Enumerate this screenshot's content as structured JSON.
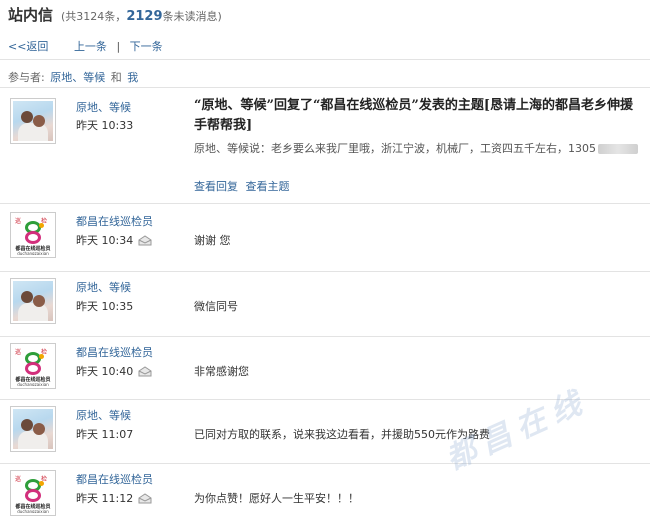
{
  "header": {
    "title": "站内信",
    "stats_prefix": "(共3124条，",
    "unread_count": "2129",
    "stats_suffix": "条未读消息)"
  },
  "nav": {
    "back": "<<返回",
    "prev": "上一条",
    "separator": "|",
    "next": "下一条"
  },
  "participants": {
    "label": "参与者:",
    "user1": "原地、等候",
    "conj": "和",
    "user2": "我"
  },
  "thread": {
    "sender": "原地、等候",
    "time": "昨天 10:33",
    "subject": "“原地、等候”回复了“都昌在线巡检员”发表的主题[恳请上海的都昌老乡伸援手帮帮我]",
    "excerpt": "原地、等候说：老乡要么来我厂里哦，浙江宁波，机械厂，工资四五千左右，1305",
    "view_reply": "查看回复",
    "view_topic": "查看主题"
  },
  "messages": [
    {
      "sender": "都昌在线巡检员",
      "time": "昨天 10:34",
      "content": "谢谢 您",
      "avatar": "logo",
      "read_icon": "envelope-icon"
    },
    {
      "sender": "原地、等候",
      "time": "昨天 10:35",
      "content": "微信同号",
      "avatar": "photo",
      "read_icon": ""
    },
    {
      "sender": "都昌在线巡检员",
      "time": "昨天 10:40",
      "content": "非常感谢您",
      "avatar": "logo",
      "read_icon": "envelope-icon"
    },
    {
      "sender": "原地、等候",
      "time": "昨天 11:07",
      "content": "已同对方取的联系，说来我这边看看，并援助550元作为路费",
      "avatar": "photo",
      "read_icon": ""
    },
    {
      "sender": "都昌在线巡检员",
      "time": "昨天 11:12",
      "content": "为你点赞！愿好人一生平安！！！",
      "avatar": "logo",
      "read_icon": "envelope-icon"
    }
  ],
  "logo_avatar": {
    "top_left": "巡",
    "top_right": "检",
    "name": "都昌在线巡检员",
    "pinyin": "duchangzaixian"
  },
  "watermark": "都昌在线",
  "colors": {
    "link": "#336699",
    "divider": "#e3e3e3"
  }
}
